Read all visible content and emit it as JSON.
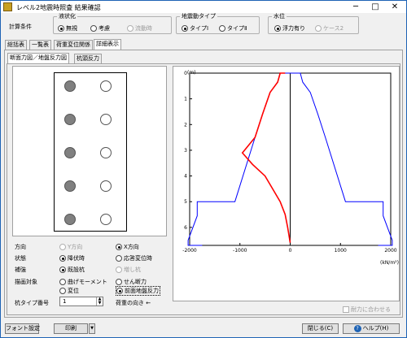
{
  "window": {
    "title": "レベル2地震時照査  結果確認",
    "min": "─",
    "max": "□",
    "close": "✕"
  },
  "conditions": {
    "label": "計算条件",
    "liquefaction": {
      "title": "液状化",
      "options": [
        {
          "label": "無視",
          "selected": true,
          "disabled": false
        },
        {
          "label": "考慮",
          "selected": false,
          "disabled": false
        },
        {
          "label": "流動時",
          "selected": false,
          "disabled": true
        }
      ]
    },
    "motion": {
      "title": "地震動タイプ",
      "options": [
        {
          "label": "タイプⅠ",
          "selected": true
        },
        {
          "label": "タイプⅡ",
          "selected": false
        }
      ]
    },
    "water": {
      "title": "水位",
      "options": [
        {
          "label": "浮力有り",
          "selected": true,
          "disabled": false
        },
        {
          "label": "ケース2",
          "selected": false,
          "disabled": true
        }
      ]
    }
  },
  "tabs": [
    "総括表",
    "一覧表",
    "荷重変位関係",
    "詳細表示"
  ],
  "subtabs": [
    "断面力図／地盤反力図",
    "杭頭反力"
  ],
  "controls": {
    "direction": {
      "label": "方向",
      "options": [
        "Y方向",
        "X方向"
      ]
    },
    "state": {
      "label": "状態",
      "options": [
        "降伏時",
        "応答変位時"
      ]
    },
    "reinforce": {
      "label": "補強",
      "options": [
        "既設杭",
        "増し杭"
      ]
    },
    "target": {
      "label": "描画対象",
      "options": [
        "曲げモーメント",
        "せん断力",
        "変位",
        "前面地盤反力"
      ]
    },
    "pile_type": {
      "label": "杭タイプ番号",
      "value": "1"
    },
    "load_dir": "荷重の向き ←"
  },
  "chart_data": {
    "type": "line",
    "ylabel": "(m)",
    "xlabel": "(kN/m²)",
    "xlim": [
      -2000,
      2000
    ],
    "ylim": [
      6.7,
      0
    ],
    "x_ticks": [
      -2000,
      -1000,
      0,
      1000,
      2000
    ],
    "y_ticks": [
      0,
      1,
      2,
      3,
      4,
      5,
      6
    ],
    "series": [
      {
        "color": "#0000ff",
        "points": [
          [
            -1750,
            6.7
          ],
          [
            -2030,
            6.7
          ],
          [
            -2030,
            6.5
          ],
          [
            -1850,
            5.55
          ],
          [
            -1850,
            5.0
          ],
          [
            -1100,
            5.0
          ],
          [
            -700,
            2.5
          ],
          [
            -550,
            1.6
          ],
          [
            -400,
            0.75
          ],
          [
            -250,
            0.35
          ],
          [
            -200,
            0
          ],
          [
            0,
            0
          ]
        ]
      },
      {
        "color": "#0000ff",
        "points": [
          [
            0,
            0
          ],
          [
            200,
            0
          ],
          [
            250,
            0.35
          ],
          [
            400,
            0.75
          ],
          [
            550,
            1.6
          ],
          [
            700,
            2.5
          ],
          [
            1100,
            5.0
          ],
          [
            1850,
            5.0
          ],
          [
            1850,
            5.55
          ],
          [
            2030,
            6.5
          ],
          [
            2030,
            6.7
          ],
          [
            1750,
            6.7
          ]
        ]
      },
      {
        "color": "#ff0000",
        "points": [
          [
            -100,
            0
          ],
          [
            -200,
            0
          ],
          [
            -250,
            0.35
          ],
          [
            -400,
            0.75
          ],
          [
            -550,
            1.6
          ],
          [
            -700,
            2.5
          ],
          [
            -950,
            3.1
          ],
          [
            -750,
            3.55
          ],
          [
            -500,
            4.0
          ],
          [
            -350,
            4.5
          ],
          [
            -200,
            5.0
          ],
          [
            -100,
            5.5
          ],
          [
            -50,
            6.0
          ],
          [
            0,
            6.6
          ]
        ]
      }
    ]
  },
  "checkbox_fit": "耐力に合わせる",
  "buttons": {
    "font": "フォント設定",
    "print": "印刷",
    "close": "閉じる(C)",
    "help": "ヘルプ(H)",
    "help_icon": "?"
  }
}
